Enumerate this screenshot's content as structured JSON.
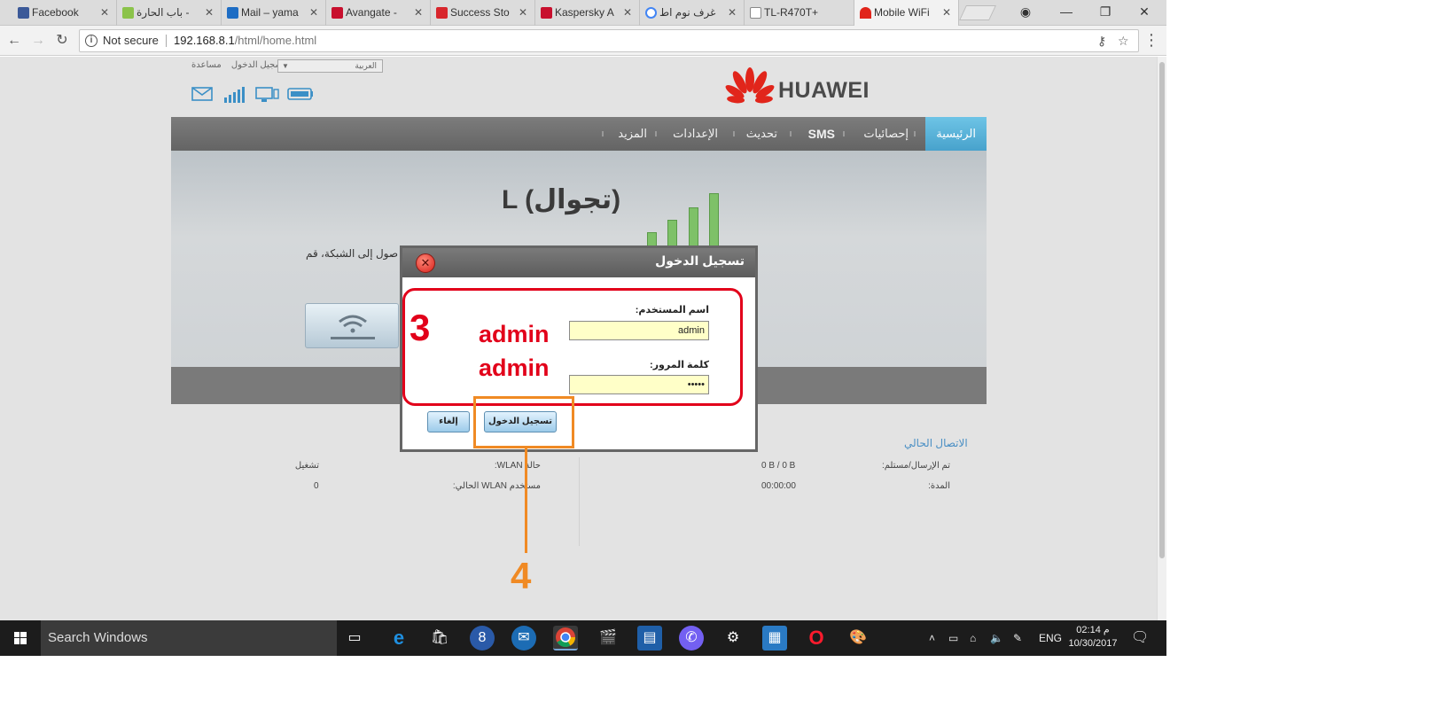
{
  "browser": {
    "tabs": [
      {
        "title": "Facebook",
        "favicon_color": "#3b5998"
      },
      {
        "title": "باب الحارة -",
        "favicon_color": "#8bc34a"
      },
      {
        "title": "Mail – yama",
        "favicon_color": "#1e6dc4"
      },
      {
        "title": "Avangate -",
        "favicon_color": "#c8102e"
      },
      {
        "title": "Success Sto",
        "favicon_color": "#d8262c"
      },
      {
        "title": "Kaspersky A",
        "favicon_color": "#c8102e"
      },
      {
        "title": "غرف نوم اط",
        "favicon_color": "#4285f4"
      },
      {
        "title": "TL-R470T+",
        "favicon_color": "#888888"
      },
      {
        "title": "Mobile WiFi",
        "favicon_color": "#e1251b"
      }
    ],
    "url_security": "Not secure",
    "url_host": "192.168.8.1",
    "url_path": "/html/home.html"
  },
  "router": {
    "login_link": "تسجيل الدخول",
    "help_link": "مساعدة",
    "language": "العربية",
    "brand": "HUAWEI",
    "nav": {
      "home": "الرئيسية",
      "stats": "إحصائيات",
      "sms": "SMS",
      "update": "تحديث",
      "settings": "الإعدادات",
      "more": "المزيد"
    },
    "network_title": "L (تجوال)",
    "hero_text": "صول إلى الشبكة، قم",
    "connection": {
      "title": "الاتصال الحالي",
      "sent_received_label": "تم الإرسال/مستلم:",
      "sent_received_value": "0 B / 0 B",
      "duration_label": "المدة:",
      "duration_value": "00:00:00",
      "wlan_status_label": "حالة WLAN:",
      "wlan_status_value": "تشغيل",
      "wlan_users_label": "مستخدم WLAN الحالي:",
      "wlan_users_value": "0"
    }
  },
  "dialog": {
    "title": "تسجيل الدخول",
    "username_label": "اسم المستخدم:",
    "username_value": "admin",
    "password_label": "كلمة المرور:",
    "password_value": "•••••",
    "login_button": "تسجيل الدخول",
    "cancel_button": "إلغاء"
  },
  "annotations": {
    "step3": "3",
    "admin_user": "admin",
    "admin_pass": "admin",
    "step4": "4",
    "red_color": "#e2001a",
    "orange_color": "#f08a24"
  },
  "taskbar": {
    "search_placeholder": "Search Windows",
    "language": "ENG",
    "time": "02:14 م",
    "date": "10/30/2017"
  }
}
